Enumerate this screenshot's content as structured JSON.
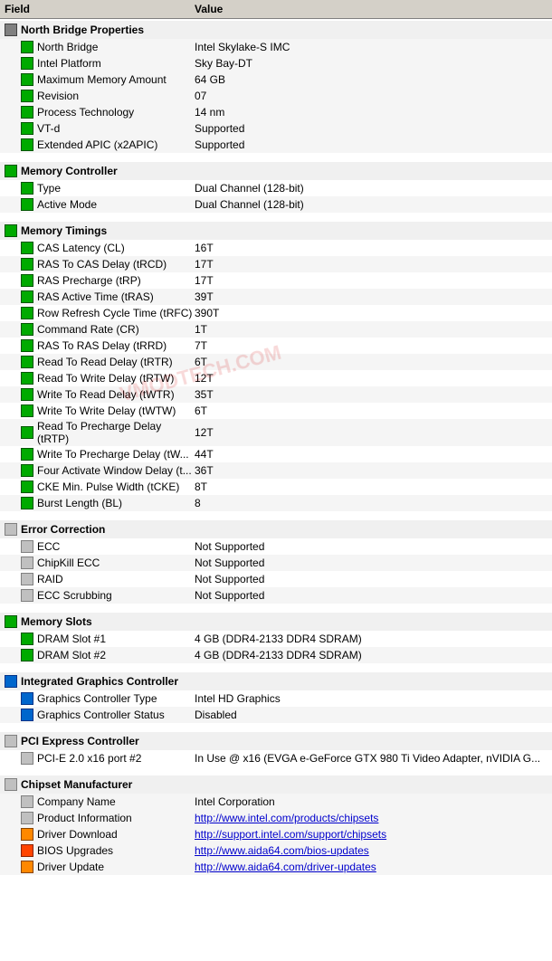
{
  "header": {
    "field_label": "Field",
    "value_label": "Value"
  },
  "watermark": "VMODTECH.COM",
  "sections": [
    {
      "id": "north-bridge-properties",
      "label": "North Bridge Properties",
      "icon_type": "nb",
      "rows": [
        {
          "field": "North Bridge",
          "value": "Intel Skylake-S IMC",
          "icon": "chip"
        },
        {
          "field": "Intel Platform",
          "value": "Sky Bay-DT",
          "icon": "chip"
        },
        {
          "field": "Maximum Memory Amount",
          "value": "64 GB",
          "icon": "chip"
        },
        {
          "field": "Revision",
          "value": "07",
          "icon": "chip"
        },
        {
          "field": "Process Technology",
          "value": "14 nm",
          "icon": "chip"
        },
        {
          "field": "VT-d",
          "value": "Supported",
          "icon": "chip"
        },
        {
          "field": "Extended APIC (x2APIC)",
          "value": "Supported",
          "icon": "chip"
        }
      ]
    },
    {
      "id": "memory-controller",
      "label": "Memory Controller",
      "icon_type": "mem",
      "rows": [
        {
          "field": "Type",
          "value": "Dual Channel  (128-bit)",
          "icon": "mem"
        },
        {
          "field": "Active Mode",
          "value": "Dual Channel  (128-bit)",
          "icon": "mem"
        }
      ]
    },
    {
      "id": "memory-timings",
      "label": "Memory Timings",
      "icon_type": "mem",
      "rows": [
        {
          "field": "CAS Latency (CL)",
          "value": "16T",
          "icon": "mem"
        },
        {
          "field": "RAS To CAS Delay (tRCD)",
          "value": "17T",
          "icon": "mem"
        },
        {
          "field": "RAS Precharge (tRP)",
          "value": "17T",
          "icon": "mem"
        },
        {
          "field": "RAS Active Time (tRAS)",
          "value": "39T",
          "icon": "mem"
        },
        {
          "field": "Row Refresh Cycle Time (tRFC)",
          "value": "390T",
          "icon": "mem"
        },
        {
          "field": "Command Rate (CR)",
          "value": "1T",
          "icon": "mem"
        },
        {
          "field": "RAS To RAS Delay (tRRD)",
          "value": "7T",
          "icon": "mem"
        },
        {
          "field": "Read To Read Delay (tRTR)",
          "value": "6T",
          "icon": "mem"
        },
        {
          "field": "Read To Write Delay (tRTW)",
          "value": "12T",
          "icon": "mem"
        },
        {
          "field": "Write To Read Delay (tWTR)",
          "value": "35T",
          "icon": "mem"
        },
        {
          "field": "Write To Write Delay (tWTW)",
          "value": "6T",
          "icon": "mem"
        },
        {
          "field": "Read To Precharge Delay (tRTP)",
          "value": "12T",
          "icon": "mem"
        },
        {
          "field": "Write To Precharge Delay (tW...",
          "value": "44T",
          "icon": "mem"
        },
        {
          "field": "Four Activate Window Delay (t...",
          "value": "36T",
          "icon": "mem"
        },
        {
          "field": "CKE Min. Pulse Width (tCKE)",
          "value": "8T",
          "icon": "mem"
        },
        {
          "field": "Burst Length (BL)",
          "value": "8",
          "icon": "mem"
        }
      ]
    },
    {
      "id": "error-correction",
      "label": "Error Correction",
      "icon_type": "ec",
      "rows": [
        {
          "field": "ECC",
          "value": "Not Supported",
          "icon": "ec"
        },
        {
          "field": "ChipKill ECC",
          "value": "Not Supported",
          "icon": "ec"
        },
        {
          "field": "RAID",
          "value": "Not Supported",
          "icon": "ec"
        },
        {
          "field": "ECC Scrubbing",
          "value": "Not Supported",
          "icon": "ec"
        }
      ]
    },
    {
      "id": "memory-slots",
      "label": "Memory Slots",
      "icon_type": "mem",
      "rows": [
        {
          "field": "DRAM Slot #1",
          "value": "4 GB  (DDR4-2133 DDR4 SDRAM)",
          "icon": "dram"
        },
        {
          "field": "DRAM Slot #2",
          "value": "4 GB  (DDR4-2133 DDR4 SDRAM)",
          "icon": "dram"
        }
      ]
    },
    {
      "id": "integrated-graphics",
      "label": "Integrated Graphics Controller",
      "icon_type": "igp",
      "rows": [
        {
          "field": "Graphics Controller Type",
          "value": "Intel HD Graphics",
          "icon": "igp"
        },
        {
          "field": "Graphics Controller Status",
          "value": "Disabled",
          "icon": "igp"
        }
      ]
    },
    {
      "id": "pci-express",
      "label": "PCI Express Controller",
      "icon_type": "pci",
      "rows": [
        {
          "field": "PCI-E 2.0 x16 port #2",
          "value": "In Use @ x16  (EVGA e-GeForce GTX 980 Ti Video Adapter, nVIDIA G...",
          "icon": "pci"
        }
      ]
    },
    {
      "id": "chipset-manufacturer",
      "label": "Chipset Manufacturer",
      "icon_type": "mfr",
      "rows": [
        {
          "field": "Company Name",
          "value": "Intel Corporation",
          "icon": "mfr"
        },
        {
          "field": "Product Information",
          "value": "http://www.intel.com/products/chipsets",
          "icon": "info",
          "link": true
        },
        {
          "field": "Driver Download",
          "value": "http://support.intel.com/support/chipsets",
          "icon": "dl",
          "link": true
        },
        {
          "field": "BIOS Upgrades",
          "value": "http://www.aida64.com/bios-updates",
          "icon": "bios",
          "link": true
        },
        {
          "field": "Driver Update",
          "value": "http://www.aida64.com/driver-updates",
          "icon": "dl",
          "link": true
        }
      ]
    }
  ]
}
